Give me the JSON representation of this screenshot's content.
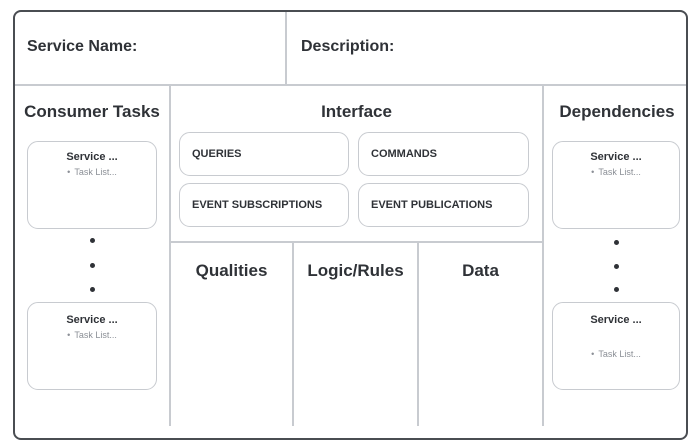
{
  "header": {
    "service_name": "Service Name:",
    "description": "Description:"
  },
  "sections": {
    "consumer_tasks": "Consumer Tasks",
    "interface": "Interface",
    "dependencies": "Dependencies",
    "qualities": "Qualities",
    "logic_rules": "Logic/Rules",
    "data": "Data"
  },
  "interface_items": {
    "queries": "QUERIES",
    "commands": "COMMANDS",
    "event_subscriptions": "EVENT SUBSCRIPTIONS",
    "event_publications": "EVENT PUBLICATIONS"
  },
  "cards": {
    "service": "Service ...",
    "task_list": "Task List...",
    "bullet": "•"
  }
}
